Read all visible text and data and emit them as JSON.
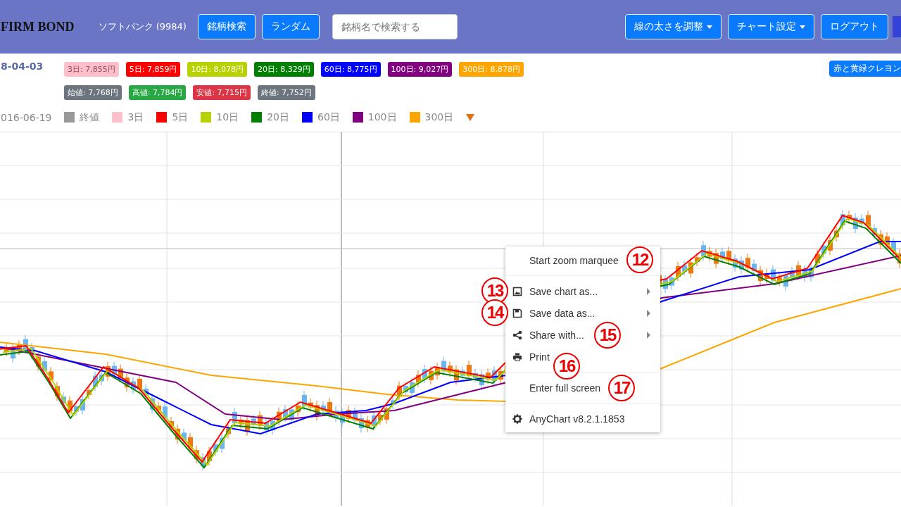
{
  "header": {
    "brand": "FIRM BOND",
    "stock": "ソフトバンク (9984)",
    "left_buttons": [
      "銘柄検索",
      "ランダム"
    ],
    "search": {
      "placeholder": "銘柄名で検索する"
    },
    "right_buttons": [
      {
        "label": "線の太さを調整",
        "dropdown": true
      },
      {
        "label": "チャート設定",
        "dropdown": true
      },
      {
        "label": "ログアウト",
        "dropdown": false
      }
    ]
  },
  "info": {
    "date": "8-04-03",
    "ma_badges": [
      {
        "label": "3日: 7,855円",
        "color": "#ffc0cb"
      },
      {
        "label": "5日: 7,859円",
        "color": "#ff0000"
      },
      {
        "label": "10日: 8,078円",
        "color": "#b8d200"
      },
      {
        "label": "20日: 8,329円",
        "color": "#008000"
      },
      {
        "label": "60日: 8,775円",
        "color": "#0000ff"
      },
      {
        "label": "100日: 9,027円",
        "color": "#800080"
      },
      {
        "label": "300日: 8,878円",
        "color": "#ffa500"
      }
    ],
    "price_badges": [
      {
        "label": "始値: 7,768円",
        "color": "#6c757d"
      },
      {
        "label": "高値: 7,784円",
        "color": "#28a745"
      },
      {
        "label": "安値: 7,715円",
        "color": "#dc3545"
      },
      {
        "label": "終値: 7,752円",
        "color": "#6c757d"
      }
    ],
    "theme_button": "赤と黄緑クレヨン"
  },
  "legend": {
    "date": "016-06-19",
    "items": [
      {
        "label": "終値",
        "color": "#999999"
      },
      {
        "label": "3日",
        "color": "#ffc0cb"
      },
      {
        "label": "5日",
        "color": "#ff0000"
      },
      {
        "label": "10日",
        "color": "#b8d200"
      },
      {
        "label": "20日",
        "color": "#008000"
      },
      {
        "label": "60日",
        "color": "#0000ff"
      },
      {
        "label": "100日",
        "color": "#800080"
      },
      {
        "label": "300日",
        "color": "#ffa500"
      }
    ]
  },
  "context_menu": {
    "groups": [
      [
        {
          "label": "Start zoom marquee",
          "submenu": false,
          "callout": "12"
        }
      ],
      [
        {
          "label": "Save chart as...",
          "submenu": true,
          "callout": "13"
        },
        {
          "label": "Save data as...",
          "submenu": true,
          "callout": "14"
        },
        {
          "label": "Share with...",
          "submenu": true,
          "callout": "15"
        },
        {
          "label": "Print",
          "submenu": false,
          "callout": "16"
        }
      ],
      [
        {
          "label": "Enter full screen",
          "submenu": false,
          "callout": "17"
        }
      ],
      [
        {
          "label": "AnyChart v8.2.1.1853",
          "submenu": false
        }
      ]
    ]
  }
}
